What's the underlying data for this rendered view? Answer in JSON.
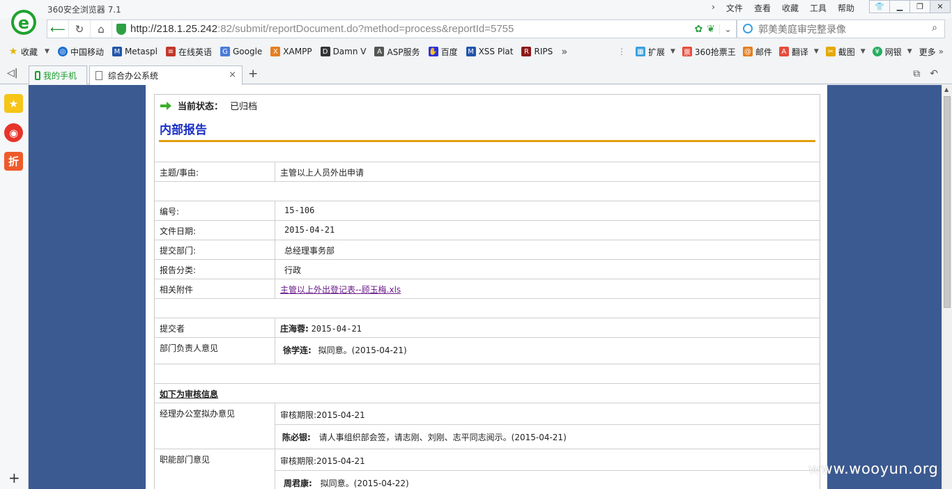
{
  "browser": {
    "title": "360安全浏览器 7.1",
    "menu": [
      "文件",
      "查看",
      "收藏",
      "工具",
      "帮助"
    ],
    "url_host": "http://218.1.25.242",
    "url_rest": ":82/submit/reportDocument.do?method=process&reportId=5755",
    "search_text": "郭美美庭审完整录像"
  },
  "bookmarks": {
    "left": [
      {
        "label": "收藏",
        "icon": "star-icon",
        "color": "#e6b400"
      },
      {
        "label": "中国移动",
        "icon": "globe-icon",
        "color": "#1d6fd1"
      },
      {
        "label": "Metaspl",
        "icon": "metasploit-icon",
        "color": "#2255aa"
      },
      {
        "label": "在线英语",
        "icon": "book-icon",
        "color": "#c0392b"
      },
      {
        "label": "Google",
        "icon": "google-icon",
        "color": "#4a7bd8"
      },
      {
        "label": "XAMPP",
        "icon": "xampp-icon",
        "color": "#e67e22"
      },
      {
        "label": "Damn V",
        "icon": "dvwa-icon",
        "color": "#333333"
      },
      {
        "label": "ASP服务",
        "icon": "asp-icon",
        "color": "#555555"
      },
      {
        "label": "百度",
        "icon": "baidu-icon",
        "color": "#2932e1"
      },
      {
        "label": "XSS Plat",
        "icon": "xss-icon",
        "color": "#2255aa"
      },
      {
        "label": "RIPS",
        "icon": "rips-icon",
        "color": "#8b1a1a"
      }
    ],
    "overflow": "»",
    "right": [
      {
        "label": "扩展",
        "icon": "extension-icon",
        "color": "#3aa0e0"
      },
      {
        "label": "360抢票王",
        "icon": "ticket-icon",
        "color": "#e74c3c"
      },
      {
        "label": "邮件",
        "icon": "mail-icon",
        "color": "#e67e22"
      },
      {
        "label": "翻译",
        "icon": "translate-icon",
        "color": "#e74c3c"
      },
      {
        "label": "截图",
        "icon": "scissors-icon",
        "color": "#e6a800"
      },
      {
        "label": "网银",
        "icon": "bank-icon",
        "color": "#27ae60"
      },
      {
        "label": "更多",
        "icon": "more-icon",
        "color": "#777777"
      }
    ]
  },
  "tabs": [
    {
      "label": "我的手机"
    },
    {
      "label": "综合办公系统"
    }
  ],
  "report": {
    "status_label": "当前状态：",
    "status_value": "已归档",
    "title": "内部报告",
    "subject_label": "主题/事由:",
    "subject_value": "主管以上人员外出申请",
    "number_label": "编号:",
    "number_value": "15-106",
    "date_label": "文件日期:",
    "date_value": "2015-04-21",
    "dept_label": "提交部门:",
    "dept_value": "总经理事务部",
    "category_label": "报告分类:",
    "category_value": "行政",
    "attachment_label": "相关附件",
    "attachment_value": "主管以上外出登记表--顾玉梅.xls",
    "submitter_label": "提交者",
    "submitter_name": "庄海蓉:",
    "submitter_date": "2015-04-21",
    "depthead_label": "部门负责人意见",
    "depthead_name": "徐学连:",
    "depthead_text": "拟同意。(2015-04-21)",
    "review_header": "如下为审核信息",
    "office_label": "经理办公室拟办意见",
    "office_deadline": "审核期限:2015-04-21",
    "office_name": "陈必银:",
    "office_text": "请人事组织部会签，请志刚、刘刚、志平同志阅示。(2015-04-21)",
    "func_label": "职能部门意见",
    "func_deadline": "审核期限:2015-04-21",
    "func_name": "周君康:",
    "func_text": "拟同意。(2015-04-22)"
  },
  "watermark": "www.wooyun.org"
}
